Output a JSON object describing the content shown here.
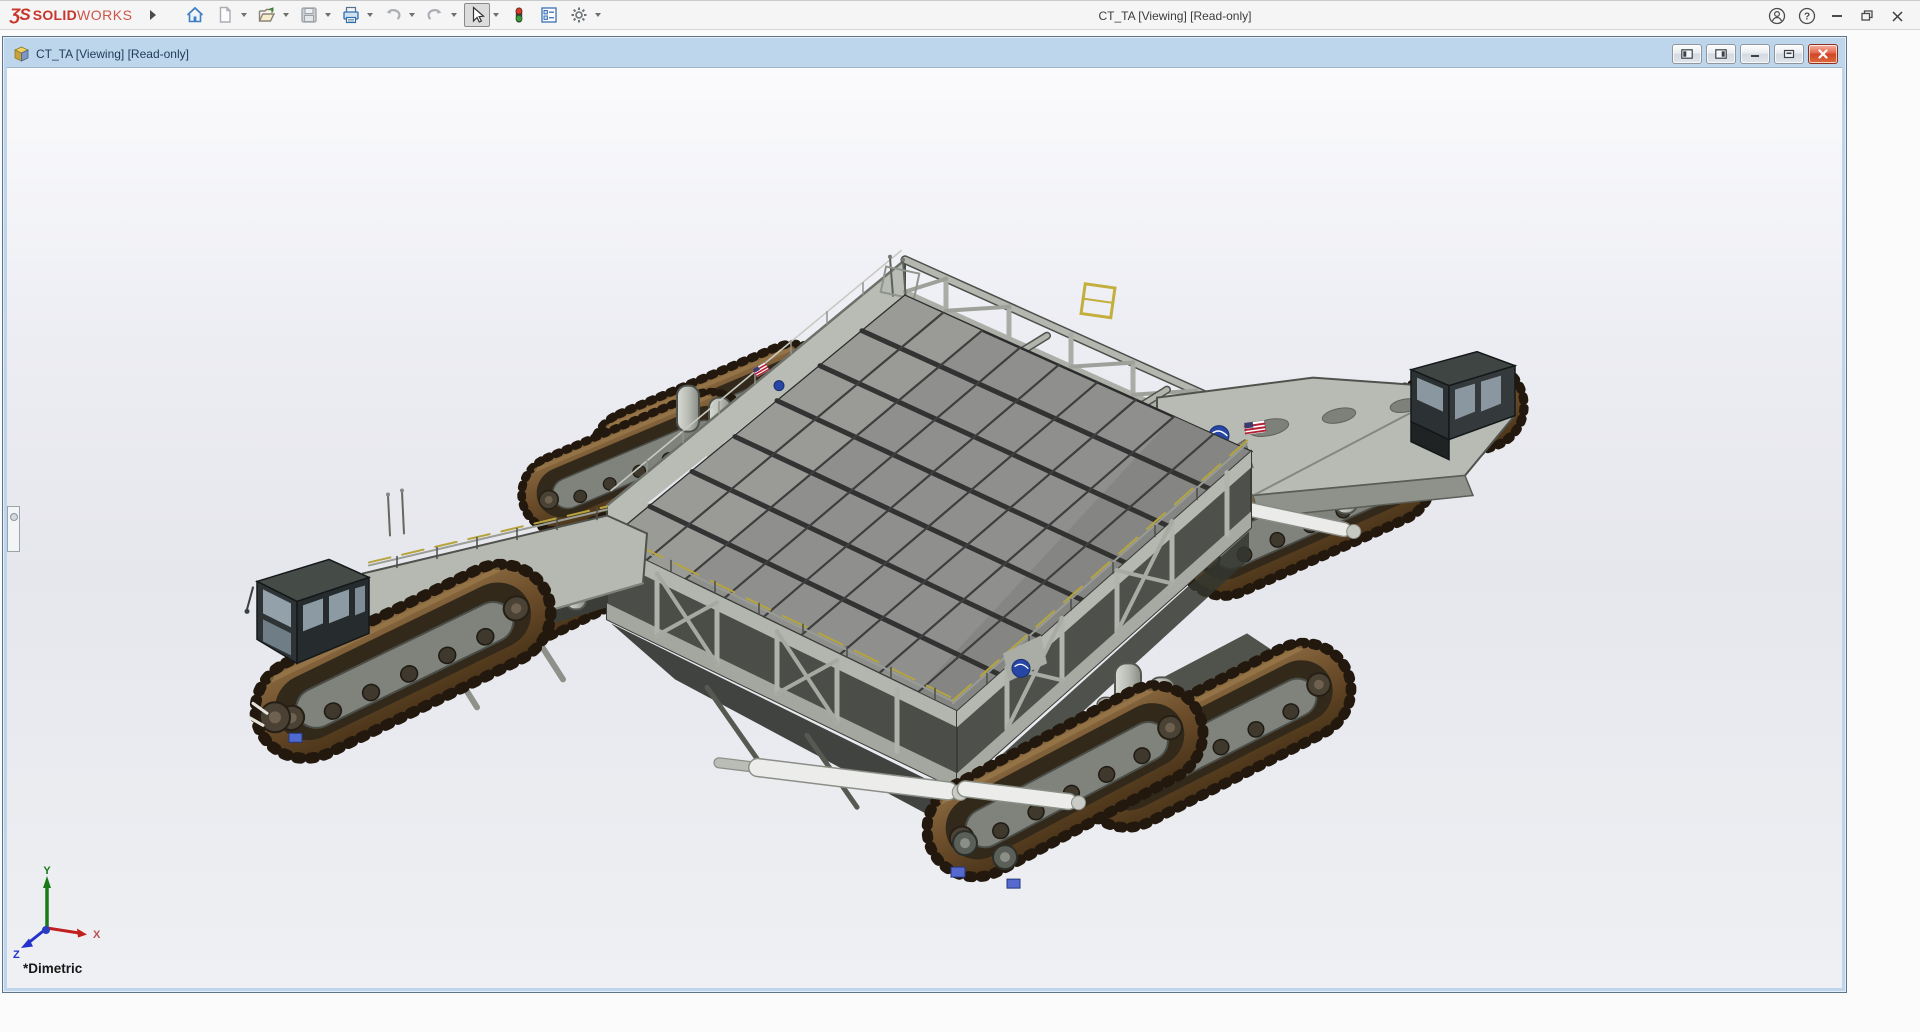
{
  "app": {
    "brand": {
      "mark": "ƷS",
      "name_bold": "SOLID",
      "name_light": "WORKS"
    },
    "title": "CT_TA [Viewing] [Read-only]",
    "icons": {
      "help_glyph": "?"
    },
    "toolbar_icons": [
      "flyout-arrow",
      "home",
      "new-document",
      "open",
      "save",
      "print",
      "undo",
      "redo",
      "select-cursor",
      "traffic-light",
      "evaluate-list",
      "options-gear"
    ],
    "window_controls": [
      "account",
      "help",
      "minimize",
      "restore",
      "close"
    ]
  },
  "document_window": {
    "title": "CT_TA [Viewing] [Read-only]",
    "controls": [
      "pane-left",
      "pane-right",
      "minimize",
      "restore",
      "close"
    ]
  },
  "viewport": {
    "view_name": "*Dimetric",
    "triad": {
      "x": "X",
      "y": "Y",
      "z": "Z"
    },
    "model": "NASA crawler-transporter 3D assembly",
    "decals": [
      "nasa-meatball",
      "us-flag"
    ]
  },
  "colors": {
    "brand_red": "#c9352b",
    "doc_titlebar_top": "#dce9f5",
    "doc_titlebar_bottom": "#b9cfe2",
    "doc_frame_blue": "#bed6ec",
    "viewport_mid": "#e6e7ed",
    "deck_gray": "#8f8f8e",
    "structure_gray": "#b6bab2",
    "track_brown": "#6e4e2b",
    "nasa_blue": "#2746a6",
    "flag_red": "#b22234",
    "close_red": "#cf4526",
    "axis_x": "#c02020",
    "axis_y": "#1a7a1a",
    "axis_z": "#2233cc"
  }
}
